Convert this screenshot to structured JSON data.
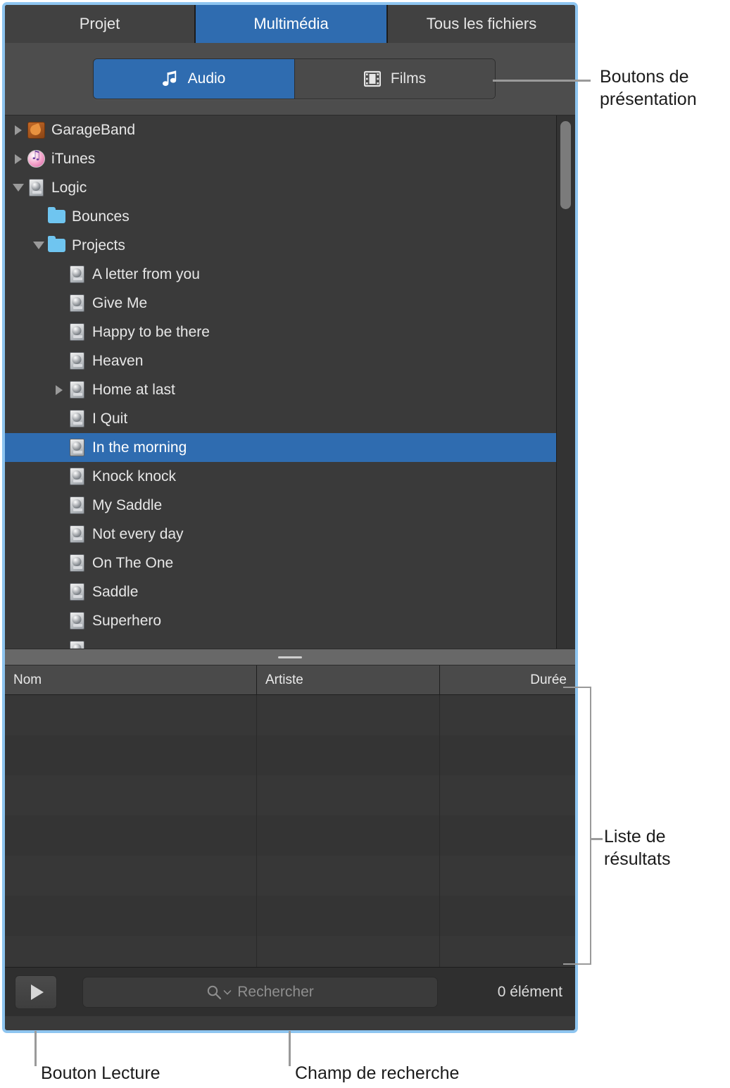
{
  "tabs": [
    {
      "label": "Projet",
      "active": false
    },
    {
      "label": "Multimédia",
      "active": true
    },
    {
      "label": "Tous les fichiers",
      "active": false
    }
  ],
  "view_buttons": [
    {
      "label": "Audio",
      "icon": "music-note-icon",
      "active": true
    },
    {
      "label": "Films",
      "icon": "film-strip-icon",
      "active": false
    }
  ],
  "tree": [
    {
      "label": "GarageBand",
      "indent": 0,
      "twisty": "closed",
      "icon": "garageband-icon",
      "selected": false
    },
    {
      "label": "iTunes",
      "indent": 0,
      "twisty": "closed",
      "icon": "itunes-icon",
      "selected": false
    },
    {
      "label": "Logic",
      "indent": 0,
      "twisty": "open",
      "icon": "disk-icon",
      "selected": false
    },
    {
      "label": "Bounces",
      "indent": 1,
      "twisty": "none",
      "icon": "folder-icon",
      "selected": false
    },
    {
      "label": "Projects",
      "indent": 1,
      "twisty": "open",
      "icon": "folder-icon",
      "selected": false
    },
    {
      "label": "A letter from you",
      "indent": 2,
      "twisty": "none",
      "icon": "disk-icon",
      "selected": false
    },
    {
      "label": "Give Me",
      "indent": 2,
      "twisty": "none",
      "icon": "disk-icon",
      "selected": false
    },
    {
      "label": "Happy to be there",
      "indent": 2,
      "twisty": "none",
      "icon": "disk-icon",
      "selected": false
    },
    {
      "label": "Heaven",
      "indent": 2,
      "twisty": "none",
      "icon": "disk-icon",
      "selected": false
    },
    {
      "label": "Home at last",
      "indent": 2,
      "twisty": "closed",
      "icon": "disk-icon",
      "selected": false
    },
    {
      "label": "I Quit",
      "indent": 2,
      "twisty": "none",
      "icon": "disk-icon",
      "selected": false
    },
    {
      "label": "In the morning",
      "indent": 2,
      "twisty": "none",
      "icon": "disk-icon",
      "selected": true
    },
    {
      "label": "Knock knock",
      "indent": 2,
      "twisty": "none",
      "icon": "disk-icon",
      "selected": false
    },
    {
      "label": "My Saddle",
      "indent": 2,
      "twisty": "none",
      "icon": "disk-icon",
      "selected": false
    },
    {
      "label": "Not every day",
      "indent": 2,
      "twisty": "none",
      "icon": "disk-icon",
      "selected": false
    },
    {
      "label": "On The One",
      "indent": 2,
      "twisty": "none",
      "icon": "disk-icon",
      "selected": false
    },
    {
      "label": "Saddle",
      "indent": 2,
      "twisty": "none",
      "icon": "disk-icon",
      "selected": false
    },
    {
      "label": "Superhero",
      "indent": 2,
      "twisty": "none",
      "icon": "disk-icon",
      "selected": false
    },
    {
      "label": "",
      "indent": 2,
      "twisty": "none",
      "icon": "disk-icon",
      "selected": false
    }
  ],
  "results_table": {
    "columns": [
      "Nom",
      "Artiste",
      "Durée"
    ],
    "rows": []
  },
  "toolbar": {
    "play_label": "Lecture",
    "search_placeholder": "Rechercher",
    "search_value": "",
    "item_count": "0 élément"
  },
  "annotations": {
    "view_buttons": "Boutons de\nprésentation",
    "results_list": "Liste de\nrésultats",
    "play_button": "Bouton Lecture",
    "search_field": "Champ de recherche"
  },
  "colors": {
    "accent_blue": "#2f6cb0",
    "window_border": "#8ec5f0",
    "tree_bg": "#3a3a3a",
    "folder_blue": "#6fc5f0"
  }
}
